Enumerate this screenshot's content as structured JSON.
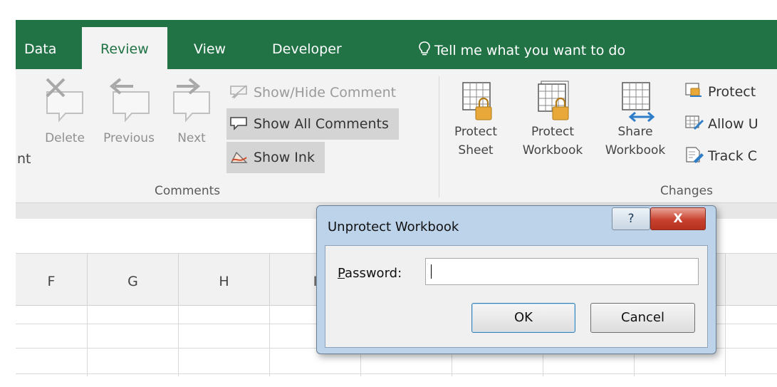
{
  "ribbon": {
    "tabs": [
      {
        "label": "Data"
      },
      {
        "label": "Review",
        "active": true
      },
      {
        "label": "View"
      },
      {
        "label": "Developer"
      }
    ],
    "tell_me": "Tell me what you want to do",
    "comments_group": {
      "cut_label": "nt",
      "delete": "Delete",
      "previous": "Previous",
      "next": "Next",
      "show_hide": "Show/Hide Comment",
      "show_all": "Show All Comments",
      "show_ink": "Show Ink",
      "group_label": "Comments"
    },
    "changes_group": {
      "protect_sheet": [
        "Protect",
        "Sheet"
      ],
      "protect_workbook": [
        "Protect",
        "Workbook"
      ],
      "share_workbook": [
        "Share",
        "Workbook"
      ],
      "protect_shared": "Protect",
      "allow_users": "Allow U",
      "track_changes": "Track C",
      "group_label": "Changes"
    }
  },
  "sheet": {
    "columns": [
      "F",
      "G",
      "H",
      "I"
    ]
  },
  "dialog": {
    "title": "Unprotect Workbook",
    "help": "?",
    "close": "X",
    "password_label_prefix": "P",
    "password_label_rest": "assword:",
    "password_value": "",
    "ok": "OK",
    "cancel": "Cancel"
  },
  "colors": {
    "ribbon_green": "#217346",
    "dialog_frame": "#bcd3ea",
    "close_red": "#c8412f"
  }
}
